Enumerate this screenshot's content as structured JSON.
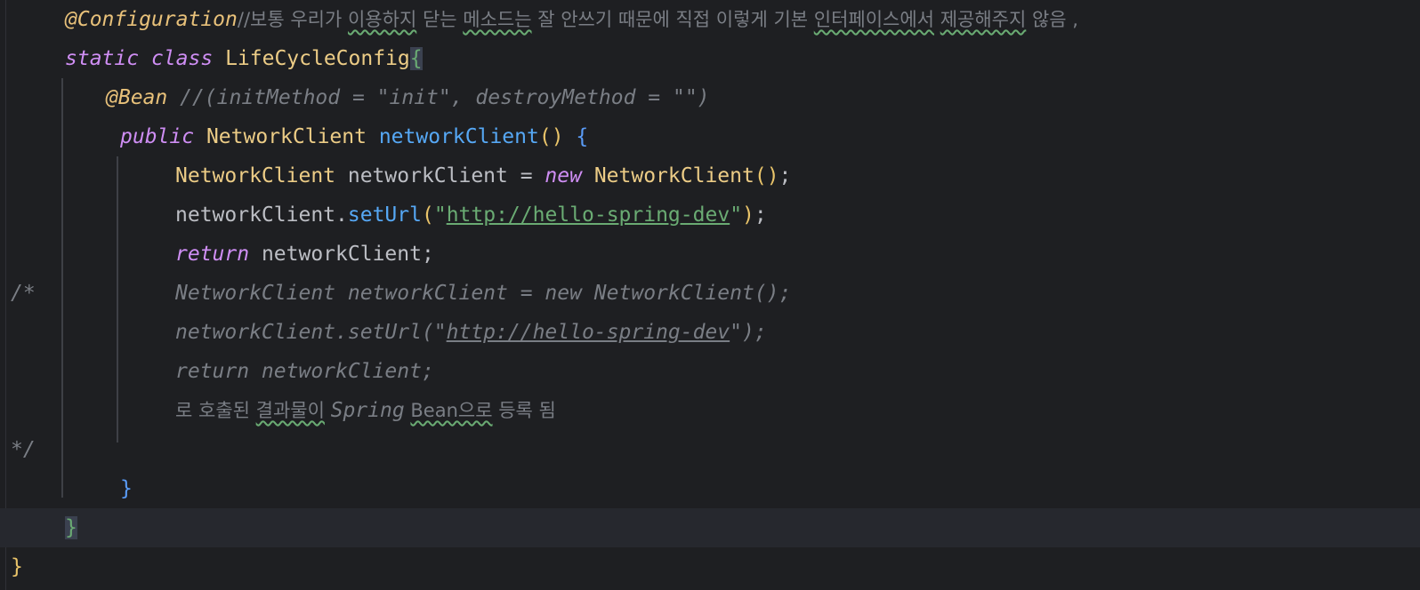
{
  "lines": {
    "l1": {
      "annotation": "@Configuration",
      "comment_slashes": "//",
      "c1": "보통 우리가 ",
      "c2": "이용하지",
      "c3": " 닫는 ",
      "c4": "메소드는",
      "c5": " 잘 안쓰기 때문에 직접 이렇게 기본 ",
      "c6": "인터페이스에서",
      "c7": " ",
      "c8": "제공해주지",
      "c9": " 않음 ,"
    },
    "l2": {
      "static": "static",
      "class": "class",
      "name": "LifeCycleConfig",
      "brace": "{"
    },
    "l3": {
      "annotation": "@Bean",
      "comment": " //(initMethod = \"init\", destroyMethod = \"\")"
    },
    "l4": {
      "public": "public",
      "type": "NetworkClient",
      "method": "networkClient",
      "parens": "()",
      "brace": "{"
    },
    "l5": {
      "type": "NetworkClient",
      "var": " networkClient = ",
      "new": "new",
      "ctor": " NetworkClient",
      "parens": "()",
      "semi": ";"
    },
    "l6": {
      "obj": "networkClient.",
      "method": "setUrl",
      "open": "(",
      "q1": "\"",
      "url": "http://hello-spring-dev",
      "q2": "\"",
      "close": ")",
      "semi": ";"
    },
    "l7": {
      "return": "return",
      "rest": " networkClient;"
    },
    "l8": {
      "marker": "/*",
      "text": "NetworkClient networkClient = new NetworkClient();"
    },
    "l9": {
      "pre": "networkClient.setUrl(\"",
      "url": "http://hello-spring-dev",
      "post": "\");"
    },
    "l10": {
      "text": "return networkClient;"
    },
    "l11": {
      "t1": "로 호출된 ",
      "t2": "결과물이",
      "t3": " ",
      "t4": "Spring",
      "t5": " ",
      "t6": "Bean으로",
      "t7": " 등록 됨"
    },
    "l12": {
      "marker": "*/"
    },
    "l13": {
      "brace": "}"
    },
    "l14": {
      "brace": "}"
    },
    "l15": {
      "brace": "}"
    }
  },
  "colors": {
    "background": "#1e1f22",
    "keyword": "#cf8ef4",
    "annotation": "#e8c17a",
    "class_name": "#eccc86",
    "method": "#56a8f5",
    "string": "#6aab73",
    "comment": "#7a7e85"
  }
}
